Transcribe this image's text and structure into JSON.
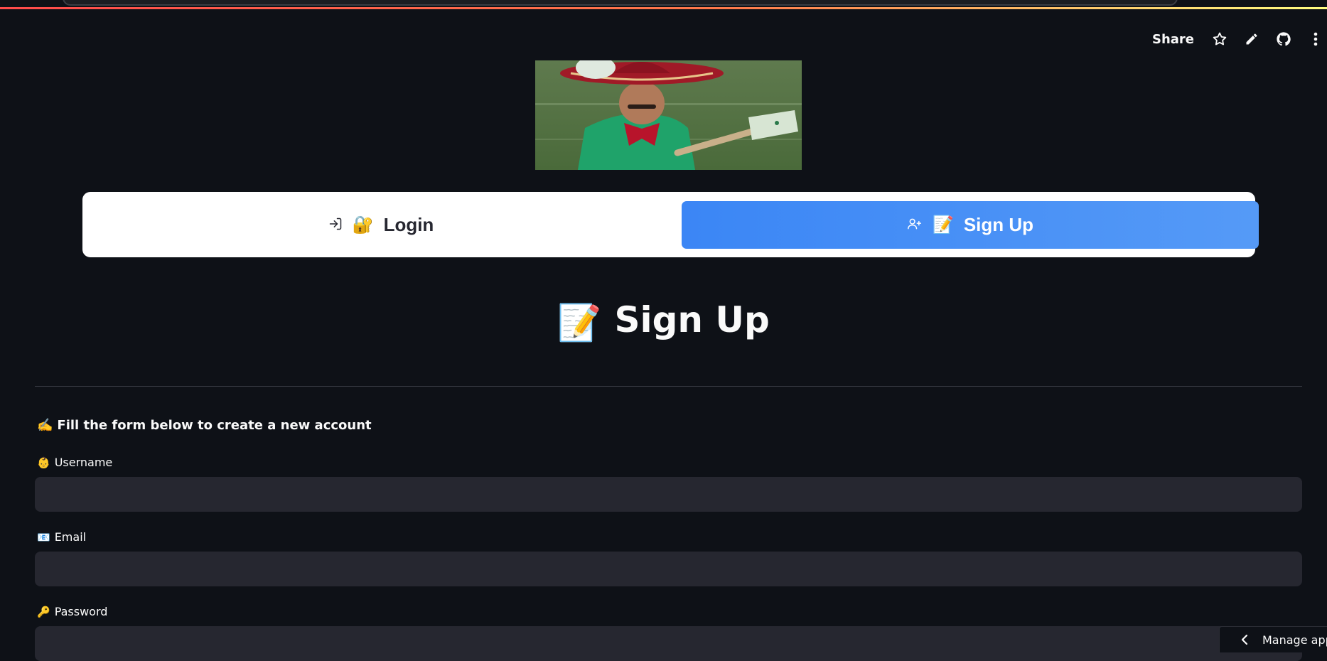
{
  "header": {
    "share_label": "Share",
    "icons": [
      "star-icon",
      "pencil-icon",
      "github-icon",
      "more-vertical-icon"
    ]
  },
  "hero": {
    "image": "mariachi-singer-gif"
  },
  "tabs": [
    {
      "label": "Login",
      "emoji": "🔐",
      "icon": "login-icon",
      "active": false
    },
    {
      "label": "Sign Up",
      "emoji": "📝",
      "icon": "add-user-icon",
      "active": true
    }
  ],
  "page": {
    "title": "Sign Up",
    "title_emoji": "📝",
    "subtitle": "Fill the form below to create a new account",
    "subtitle_emoji": "✍️"
  },
  "form": {
    "username": {
      "label": "Username",
      "emoji": "👶",
      "value": ""
    },
    "email": {
      "label": "Email",
      "emoji": "📧",
      "value": ""
    },
    "password": {
      "label": "Password",
      "emoji": "🔑",
      "value": ""
    }
  },
  "footer": {
    "manage_label": "Manage app"
  },
  "colors": {
    "background": "#0e1117",
    "input_bg": "#262730",
    "active_tab": "#3b86f5",
    "text": "#fafafa"
  }
}
